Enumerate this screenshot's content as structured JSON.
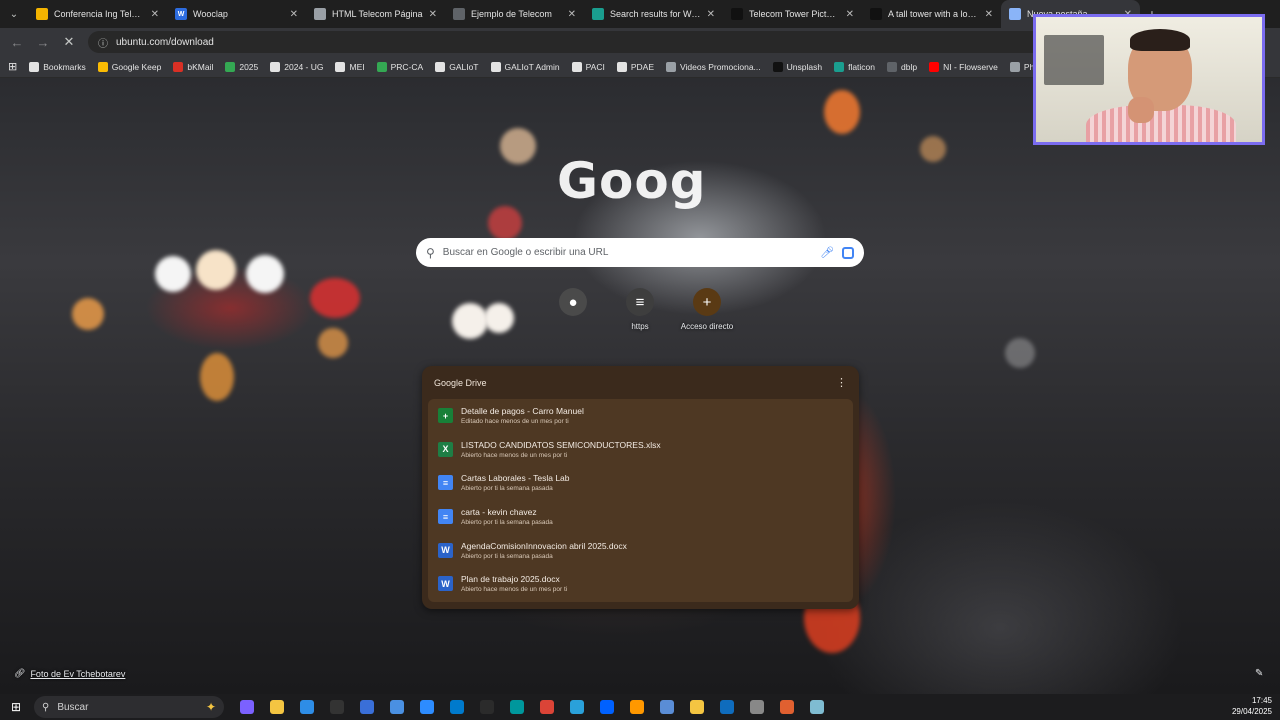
{
  "tabs": [
    {
      "title": "Conferencia Ing Telecom",
      "favicon_color": "#f4b400",
      "favicon_letter": "",
      "active": false
    },
    {
      "title": "Wooclap",
      "favicon_color": "#2d6cdf",
      "favicon_letter": "W",
      "active": false
    },
    {
      "title": "HTML Telecom Página",
      "favicon_color": "#9aa0a6",
      "favicon_letter": "",
      "active": false
    },
    {
      "title": "Ejemplo de Telecom",
      "favicon_color": "#5f6368",
      "favicon_letter": "",
      "active": false
    },
    {
      "title": "Search results for Web - F",
      "favicon_color": "#1a9e8f",
      "favicon_letter": "",
      "active": false
    },
    {
      "title": "Telecom Tower Pictures |",
      "favicon_color": "#111111",
      "favicon_letter": "",
      "active": false
    },
    {
      "title": "A tall tower with a lot of",
      "favicon_color": "#111111",
      "favicon_letter": "",
      "active": false
    },
    {
      "title": "Nueva pestaña",
      "favicon_color": "#8ab4f8",
      "favicon_letter": "",
      "active": true
    }
  ],
  "toolbar": {
    "url": "ubuntu.com/download"
  },
  "bookmarks": [
    {
      "label": "Bookmarks",
      "color": "#e3e3e3"
    },
    {
      "label": "Google Keep",
      "color": "#fbbc04"
    },
    {
      "label": "bKMail",
      "color": "#d93025"
    },
    {
      "label": "2025",
      "color": "#34a853"
    },
    {
      "label": "2024 - UG",
      "color": "#e3e3e3"
    },
    {
      "label": "MEI",
      "color": "#e3e3e3"
    },
    {
      "label": "PRC-CA",
      "color": "#34a853"
    },
    {
      "label": "GALIoT",
      "color": "#e3e3e3"
    },
    {
      "label": "GALIoT Admin",
      "color": "#e3e3e3"
    },
    {
      "label": "PACI",
      "color": "#e3e3e3"
    },
    {
      "label": "PDAE",
      "color": "#e3e3e3"
    },
    {
      "label": "Videos Promociona...",
      "color": "#9aa0a6"
    },
    {
      "label": "Unsplash",
      "color": "#111111"
    },
    {
      "label": "flaticon",
      "color": "#1a9e8f"
    },
    {
      "label": "dblp",
      "color": "#5f6368"
    },
    {
      "label": "NI - Flowserve",
      "color": "#ff0000"
    },
    {
      "label": "PhD",
      "color": "#9aa0a6"
    }
  ],
  "newtab": {
    "logo_text": "Goog",
    "search_placeholder": "Buscar en Google o escribir una URL",
    "shortcuts": [
      {
        "label": "",
        "color": "#4a4a4a",
        "glyph": "●"
      },
      {
        "label": "https",
        "color": "#3e3e3e",
        "glyph": "≡"
      },
      {
        "label": "Acceso directo",
        "color": "#5a3a14",
        "glyph": "+"
      }
    ],
    "photo_credit": "Foto de Ev Tchebotarev"
  },
  "drive": {
    "title": "Google Drive",
    "items": [
      {
        "title": "Detalle de pagos - Carro Manuel",
        "subtitle": "Editado hace menos de un mes por ti",
        "type": "sheets",
        "icon_color": "#188038",
        "icon_glyph": "+"
      },
      {
        "title": "LISTADO CANDIDATOS SEMICONDUCTORES.xlsx",
        "subtitle": "Abierto hace menos de un mes por ti",
        "type": "excel",
        "icon_color": "#1e7e45",
        "icon_glyph": "X"
      },
      {
        "title": "Cartas Laborales - Tesla Lab",
        "subtitle": "Abierto por ti la semana pasada",
        "type": "docs",
        "icon_color": "#4285f4",
        "icon_glyph": "≡"
      },
      {
        "title": "carta - kevin chavez",
        "subtitle": "Abierto por ti la semana pasada",
        "type": "docs",
        "icon_color": "#4285f4",
        "icon_glyph": "≡"
      },
      {
        "title": "AgendaComisionInnovacion abril 2025.docx",
        "subtitle": "Abierto por ti la semana pasada",
        "type": "word",
        "icon_color": "#2b63c9",
        "icon_glyph": "W"
      },
      {
        "title": "Plan de trabajo 2025.docx",
        "subtitle": "Abierto hace menos de un mes por ti",
        "type": "word",
        "icon_color": "#2b63c9",
        "icon_glyph": "W"
      }
    ]
  },
  "taskbar": {
    "search_label": "Buscar",
    "time": "17:45",
    "date": "29/04/2025",
    "apps": [
      {
        "name": "copilot",
        "color": "#7b61ff"
      },
      {
        "name": "file-explorer",
        "color": "#f4c542"
      },
      {
        "name": "edge",
        "color": "#2e8de6"
      },
      {
        "name": "github",
        "color": "#333333"
      },
      {
        "name": "app-globe",
        "color": "#3a6fd8"
      },
      {
        "name": "remote",
        "color": "#4a90e2"
      },
      {
        "name": "zoom",
        "color": "#2d8cff"
      },
      {
        "name": "vscode",
        "color": "#007acc"
      },
      {
        "name": "terminal",
        "color": "#2b2b2b"
      },
      {
        "name": "arduino",
        "color": "#00979c"
      },
      {
        "name": "chrome",
        "color": "#db4437"
      },
      {
        "name": "telegram",
        "color": "#2aa1da"
      },
      {
        "name": "dropbox",
        "color": "#0061ff"
      },
      {
        "name": "sublime",
        "color": "#ff9800"
      },
      {
        "name": "network",
        "color": "#5a8dd6"
      },
      {
        "name": "app-square",
        "color": "#f4c542"
      },
      {
        "name": "outlook",
        "color": "#0f6cbd"
      },
      {
        "name": "app-bird",
        "color": "#888888"
      },
      {
        "name": "app-doc",
        "color": "#e06030"
      },
      {
        "name": "notepad",
        "color": "#7fbcd2"
      }
    ]
  }
}
